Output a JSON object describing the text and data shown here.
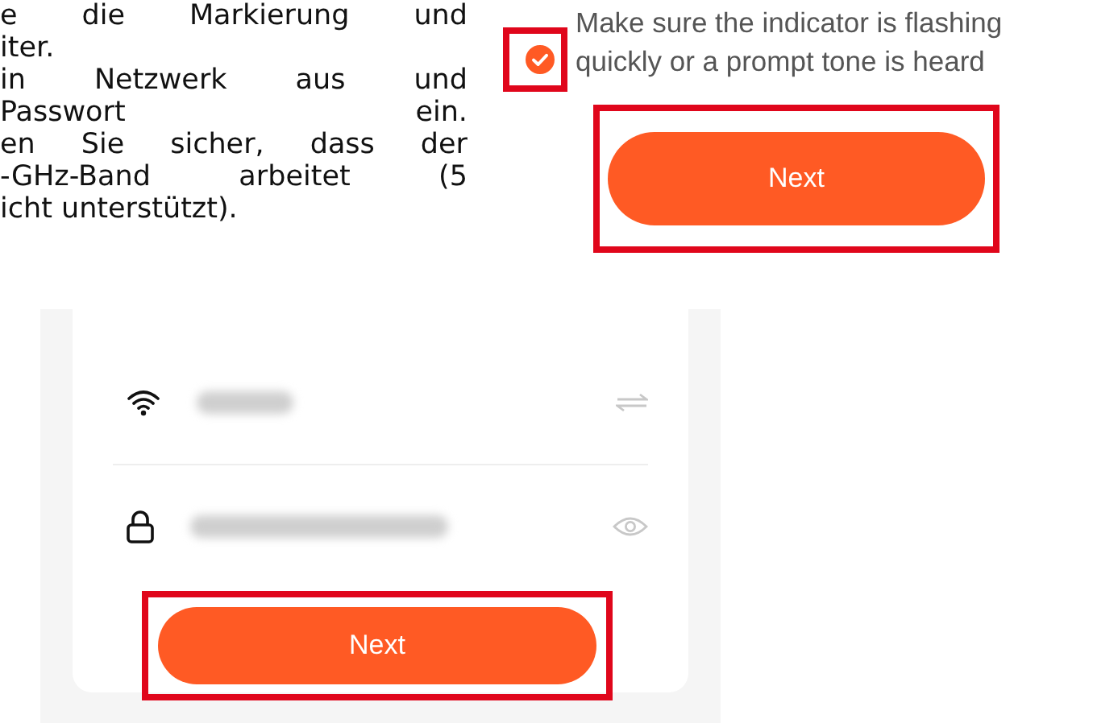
{
  "instructions": {
    "lines": [
      "e die Markierung und",
      "iter.",
      "in Netzwerk aus und",
      "Passwort ein.",
      "en Sie sicher, dass der",
      "-GHz-Band arbeitet (5",
      "icht unterstützt)."
    ]
  },
  "indicator_step": {
    "confirm": {
      "checked": true,
      "label": "Make sure the indicator is flashing quickly or a prompt tone is heard"
    },
    "next_button": "Next"
  },
  "wifi_step": {
    "next_button": "Next"
  }
}
